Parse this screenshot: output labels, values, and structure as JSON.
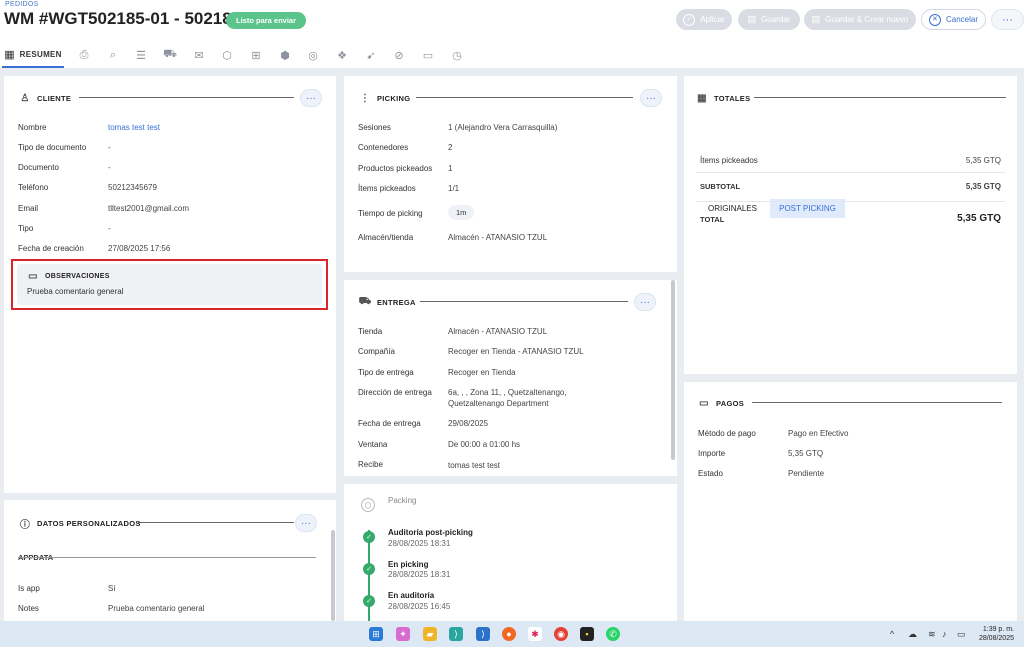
{
  "header": {
    "breadcrumb": "PEDIDOS",
    "title": "WM #WGT502185-01 - 502185",
    "status": "Listo para enviar",
    "actions": {
      "apply": "Aplicar",
      "save": "Guardar",
      "save_new": "Guardar & Crear nuevo",
      "cancel": "Cancelar",
      "more": "···"
    }
  },
  "tabs": {
    "active": "RESUMEN"
  },
  "cliente": {
    "title": "CLIENTE",
    "rows": [
      {
        "label": "Nombre",
        "value": "tomas test test"
      },
      {
        "label": "Tipo de documento",
        "value": "-"
      },
      {
        "label": "Documento",
        "value": "-"
      },
      {
        "label": "Teléfono",
        "value": "50212345679"
      },
      {
        "label": "Email",
        "value": "tlltest2001@gmail.com"
      },
      {
        "label": "Tipo",
        "value": "-"
      },
      {
        "label": "Fecha de creación",
        "value": "27/08/2025 17:56"
      }
    ],
    "observaciones": {
      "title": "OBSERVACIONES",
      "text": "Prueba comentario general"
    }
  },
  "datos": {
    "title": "DATOS PERSONALIZADOS",
    "subtitle": "APPDATA",
    "rows": [
      {
        "label": "Is app",
        "value": "Sí"
      },
      {
        "label": "Notes",
        "value": "Prueba comentario general"
      }
    ]
  },
  "picking": {
    "title": "PICKING",
    "rows": [
      {
        "label": "Sesiones",
        "value": "1 (Alejandro Vera Carrasquilla)"
      },
      {
        "label": "Contenedores",
        "value": "2"
      },
      {
        "label": "Productos pickeados",
        "value": "1"
      },
      {
        "label": "Ítems pickeados",
        "value": "1/1"
      },
      {
        "label": "Tiempo de picking",
        "value": "1m"
      },
      {
        "label": "Almacén/tienda",
        "value": "Almacén - ATANASIO TZUL"
      }
    ]
  },
  "entrega": {
    "title": "ENTREGA",
    "rows": [
      {
        "label": "Tienda",
        "value": "Almacén - ATANASIO TZUL"
      },
      {
        "label": "Compañía",
        "value": "Recoger en Tienda - ATANASIO TZUL"
      },
      {
        "label": "Tipo de entrega",
        "value": "Recoger en Tienda"
      },
      {
        "label": "Dirección de entrega",
        "value": "6a, , , Zona 11, , Quetzaltenango,",
        "value2": "Quetzaltenango Department"
      },
      {
        "label": "Fecha de entrega",
        "value": "29/08/2025"
      },
      {
        "label": "Ventana",
        "value": "De 00:00 a 01:00 hs"
      },
      {
        "label": "Recibe",
        "value": "tomas test test"
      }
    ]
  },
  "packing": {
    "title": "Packing",
    "events": [
      {
        "name": "Auditoría post-picking",
        "date": "28/08/2025 18:31"
      },
      {
        "name": "En picking",
        "date": "28/08/2025 18:31"
      },
      {
        "name": "En auditoría",
        "date": "28/08/2025 16:45"
      }
    ]
  },
  "totales": {
    "title": "TOTALES",
    "toggle": [
      "ORIGINALES",
      "POST PICKING"
    ],
    "items_label": "Ítems pickeados",
    "items_value": "5,35 GTQ",
    "subtotal_label": "SUBTOTAL",
    "subtotal_value": "5,35 GTQ",
    "total_label": "TOTAL",
    "total_value": "5,35 GTQ"
  },
  "pagos": {
    "title": "PAGOS",
    "rows": [
      {
        "label": "Método de pago",
        "value": "Pago en Efectivo"
      },
      {
        "label": "Importe",
        "value": "5,35 GTQ"
      },
      {
        "label": "Estado",
        "value": "Pendiente"
      }
    ]
  },
  "taskbar": {
    "time": "1:39 p. m.",
    "date": "28/08/2025"
  },
  "colors": {
    "accent": "#3b6fd4",
    "success": "#5bc48a",
    "highlight": "#d9262a"
  }
}
